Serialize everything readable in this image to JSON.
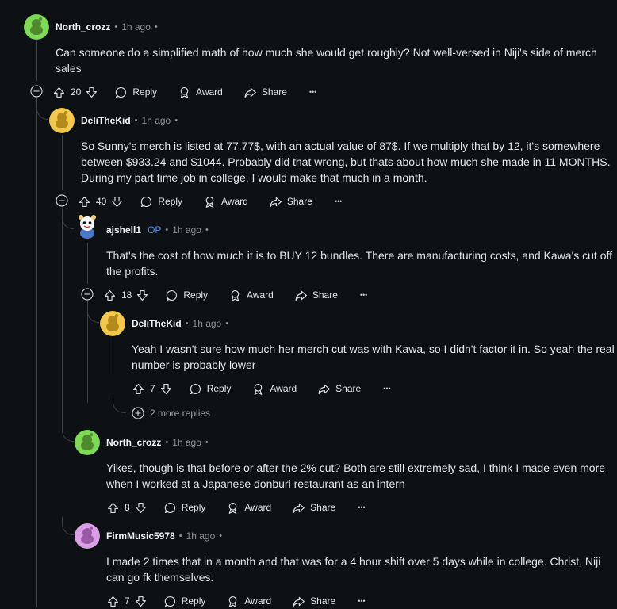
{
  "comments": [
    {
      "author": "North_crozz",
      "time": "1h ago",
      "body": [
        "Can someone do a simplified math of how much she would get roughly? Not well-versed in Niji's side of merch",
        "sales"
      ],
      "votes": "20",
      "avatar_color": "#7ed957"
    },
    {
      "author": "DeliTheKid",
      "time": "1h ago",
      "body": [
        "So Sunny's merch is listed at 77.77$, with an actual value of 87$. If we multiply that by 12, it's somewhere",
        "between $933.24 and $1044. Probably did that wrong, but thats about how much she made in 11 MONTHS.",
        "During my part time job in college, I would make that much in a month."
      ],
      "votes": "40",
      "avatar_color": "#f2c94c"
    },
    {
      "author": "ajshell1",
      "op_badge": "OP",
      "time": "1h ago",
      "body": [
        "That's the cost of how much it is to BUY 12 bundles. There are manufacturing costs, and Kawa's cut off",
        "the profits."
      ],
      "votes": "18",
      "avatar_color": "#ffffff"
    },
    {
      "author": "DeliTheKid",
      "time": "1h ago",
      "body": [
        "Yeah I wasn't sure how much her merch cut was with Kawa, so I didn't factor it in. So yeah the real",
        "number is probably lower"
      ],
      "votes": "7",
      "avatar_color": "#f2c94c"
    },
    {
      "author": "North_crozz",
      "time": "1h ago",
      "body": [
        "Yikes, though is that before or after the 2% cut? Both are still extremely sad, I think I made even more",
        "when I worked at a Japanese donburi restaurant as an intern"
      ],
      "votes": "8",
      "avatar_color": "#7ed957"
    },
    {
      "author": "FirmMusic5978",
      "time": "1h ago",
      "body": [
        "I made 2 times that in a month and that was for a 4 hour shift over 5 days while in college. Christ, Niji",
        "can go fk themselves."
      ],
      "votes": "7",
      "avatar_color": "#d99fe6"
    }
  ],
  "actions": {
    "reply": "Reply",
    "award": "Award",
    "share": "Share",
    "more": "•••"
  },
  "more_replies": "2 more replies",
  "meta_dot": "•"
}
